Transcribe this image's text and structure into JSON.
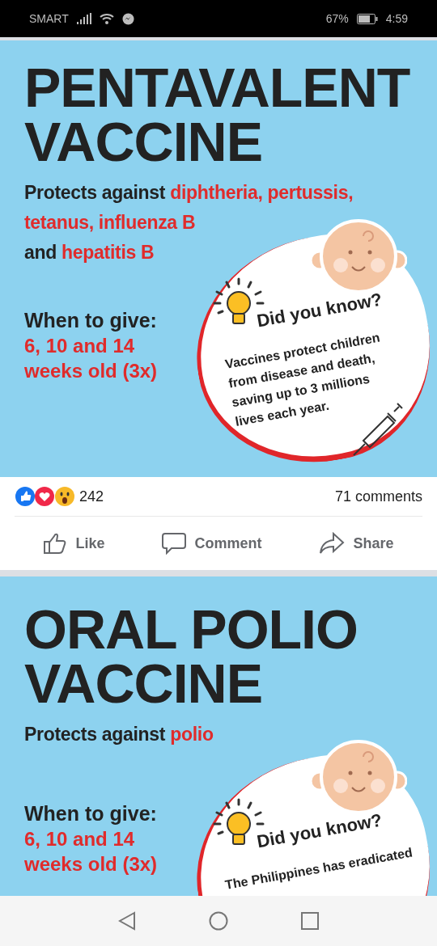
{
  "status_bar": {
    "carrier": "SMART",
    "battery": "67%",
    "time": "4:59"
  },
  "posts": [
    {
      "poster": {
        "title_lines": [
          "PENTAVALENT",
          "VACCINE"
        ],
        "protects_lines": [
          [
            {
              "text": "Protects against ",
              "highlight": false
            },
            {
              "text": "diphtheria, pertussis,",
              "highlight": true
            }
          ],
          [
            {
              "text": "tetanus, influenza B",
              "highlight": true
            }
          ],
          [
            {
              "text": "and ",
              "highlight": false
            },
            {
              "text": "hepatitis B",
              "highlight": true
            }
          ]
        ],
        "when_label": "When to give:",
        "when_lines": [
          "6, 10 and 14",
          "weeks old (3x)"
        ],
        "bubble": {
          "heading": "Did you know?",
          "body_lines": [
            "Vaccines protect children",
            "from disease and death,",
            "saving up to 3 millions",
            "lives each year."
          ]
        }
      },
      "footer": {
        "reaction_count": "242",
        "comments": "71 comments",
        "actions": [
          {
            "kind": "like",
            "label": "Like"
          },
          {
            "kind": "comment",
            "label": "Comment"
          },
          {
            "kind": "share",
            "label": "Share"
          }
        ]
      }
    },
    {
      "poster": {
        "title_lines": [
          "ORAL POLIO",
          "VACCINE"
        ],
        "protects_lines": [
          [
            {
              "text": "Protects against ",
              "highlight": false
            },
            {
              "text": "polio",
              "highlight": true
            }
          ]
        ],
        "when_label": "When to give:",
        "when_lines": [
          "6, 10 and 14",
          "weeks old (3x)"
        ],
        "bubble": {
          "heading": "Did you know?",
          "body_lines": [
            "The Philippines has eradicated"
          ]
        }
      }
    }
  ]
}
